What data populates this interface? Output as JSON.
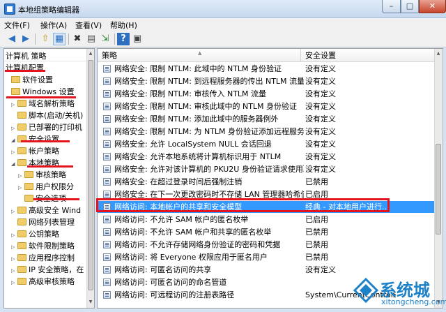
{
  "window": {
    "title": "本地组策略编辑器",
    "min": "–",
    "max": "□",
    "close": "✕"
  },
  "menu": [
    "文件(F)",
    "操作(A)",
    "查看(V)",
    "帮助(H)"
  ],
  "toolbar": {
    "back": "◀",
    "forward": "▶",
    "up": "⇧",
    "view": "▦",
    "delete": "✖",
    "properties": "▤",
    "export": "⇲",
    "help": "?",
    "extended": "▣"
  },
  "tree": {
    "header": "计算机 策略",
    "items": [
      {
        "label": "计算机配置",
        "level": 0,
        "expander": ""
      },
      {
        "label": "软件设置",
        "level": 1,
        "expander": ""
      },
      {
        "label": "Windows 设置",
        "level": 1,
        "expander": ""
      },
      {
        "label": "域名解析策略",
        "level": 2,
        "expander": "▷"
      },
      {
        "label": "脚本(启动/关机)",
        "level": 2,
        "expander": ""
      },
      {
        "label": "已部署的打印机",
        "level": 2,
        "expander": "▷"
      },
      {
        "label": "安全设置",
        "level": 2,
        "expander": "◢"
      },
      {
        "label": "帐户策略",
        "level": 3,
        "expander": "▷"
      },
      {
        "label": "本地策略",
        "level": 3,
        "expander": "◢"
      },
      {
        "label": "审核策略",
        "level": 4,
        "expander": "▷"
      },
      {
        "label": "用户权限分",
        "level": 4,
        "expander": "▷"
      },
      {
        "label": "安全选项",
        "level": 4,
        "expander": ""
      },
      {
        "label": "高级安全 Wind",
        "level": 3,
        "expander": "▷"
      },
      {
        "label": "网络列表管理",
        "level": 3,
        "expander": ""
      },
      {
        "label": "公钥策略",
        "level": 3,
        "expander": "▷"
      },
      {
        "label": "软件限制策略",
        "level": 3,
        "expander": "▷"
      },
      {
        "label": "应用程序控制",
        "level": 3,
        "expander": "▷"
      },
      {
        "label": "IP 安全策略，在",
        "level": 3,
        "expander": "▷"
      },
      {
        "label": "高级审核策略",
        "level": 3,
        "expander": "▷"
      }
    ]
  },
  "list": {
    "col_policy": "策略",
    "col_setting": "安全设置",
    "rows": [
      {
        "name": "网络安全: 限制 NTLM: 此域中的 NTLM 身份验证",
        "setting": "没有定义"
      },
      {
        "name": "网络安全: 限制 NTLM: 到远程服务器的传出 NTLM 流量",
        "setting": "没有定义"
      },
      {
        "name": "网络安全: 限制 NTLM: 审核传入 NTLM 流量",
        "setting": "没有定义"
      },
      {
        "name": "网络安全: 限制 NTLM: 审核此域中的 NTLM 身份验证",
        "setting": "没有定义"
      },
      {
        "name": "网络安全: 限制 NTLM: 添加此域中的服务器例外",
        "setting": "没有定义"
      },
      {
        "name": "网络安全: 限制 NTLM: 为 NTLM 身份验证添加远程服务器...",
        "setting": "没有定义"
      },
      {
        "name": "网络安全: 允许 LocalSystem NULL 会话回退",
        "setting": "没有定义"
      },
      {
        "name": "网络安全: 允许本地系统将计算机标识用于 NTLM",
        "setting": "没有定义"
      },
      {
        "name": "网络安全: 允许对该计算机的 PKU2U 身份验证请求使用联...",
        "setting": "没有定义"
      },
      {
        "name": "网络安全: 在超过登录时间后强制注销",
        "setting": "已禁用"
      },
      {
        "name": "网络安全: 在下一次更改密码时不存储 LAN 管理器哈希值",
        "setting": "已启用"
      },
      {
        "name": "网络访问: 本地帐户的共享和安全模型",
        "setting": "经典 - 对本地用户进行...",
        "selected": true
      },
      {
        "name": "网络访问: 不允许 SAM 帐户的匿名枚举",
        "setting": "已启用"
      },
      {
        "name": "网络访问: 不允许 SAM 帐户和共享的匿名枚举",
        "setting": "已禁用"
      },
      {
        "name": "网络访问: 不允许存储网络身份验证的密码和凭据",
        "setting": "已禁用"
      },
      {
        "name": "网络访问: 将 Everyone 权限应用于匿名用户",
        "setting": "已禁用"
      },
      {
        "name": "网络访问: 可匿名访问的共享",
        "setting": "没有定义"
      },
      {
        "name": "网络访问: 可匿名访问的命名管道",
        "setting": ""
      },
      {
        "name": "网络访问: 可远程访问的注册表路径",
        "setting": "System\\CurrentControlSet\\..."
      }
    ]
  },
  "watermark": {
    "brand": "系统城",
    "url": "xitongcheng.com"
  },
  "colors": {
    "selection": "#3399ff",
    "annotation_red": "#e2141f",
    "watermark": "#1e82c9"
  }
}
